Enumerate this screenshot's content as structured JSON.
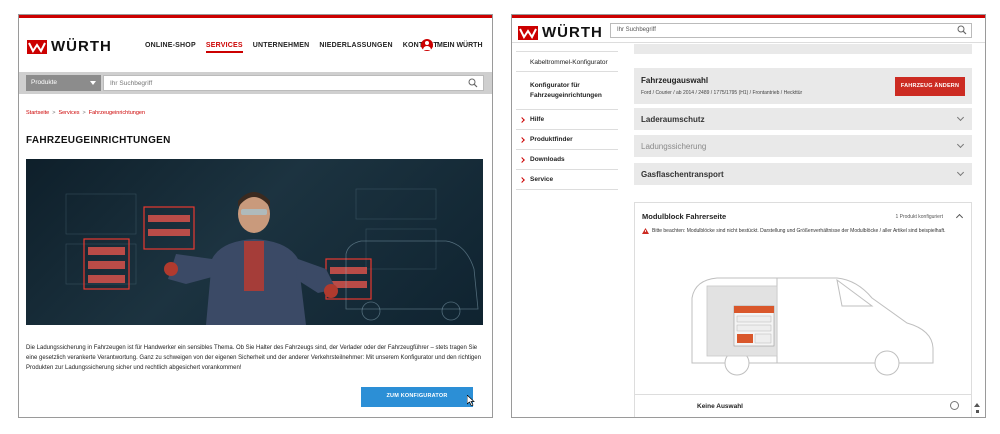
{
  "brand": {
    "name": "WÜRTH",
    "accent": "#cc0000",
    "cta_blue": "#2c8fd6",
    "button_red": "#cc2b22"
  },
  "left": {
    "nav": [
      "ONLINE-SHOP",
      "SERVICES",
      "UNTERNEHMEN",
      "NIEDERLASSUNGEN",
      "KONTAKT"
    ],
    "nav_active": "SERVICES",
    "account_label": "MEIN WÜRTH",
    "search": {
      "category": "Produkte",
      "placeholder": "Ihr Suchbegriff"
    },
    "breadcrumb": [
      "Startseite",
      "Services",
      "Fahrzeugeinrichtungen"
    ],
    "page_title": "FAHRZEUGEINRICHTUNGEN",
    "intro": "Die Ladungssicherung in Fahrzeugen ist für Handwerker ein sensibles Thema. Ob Sie Halter des Fahrzeugs sind, der Verlader oder der Fahrzeugführer – stets tragen Sie eine gesetzlich verankerte Verantwortung. Ganz zu schweigen von der eigenen Sicherheit und der anderer Verkehrsteilnehmer: Mit unserem Konfigurator und den richtigen Produkten zur Ladungssicherung sicher und rechtlich abgesichert vorankommen!",
    "cta_label": "ZUM KONFIGURATOR"
  },
  "right": {
    "search_placeholder": "Ihr Suchbegriff",
    "sidebar": {
      "sub_items": [
        "Kabeltrommel-Konfigurator",
        "Konfigurator für Fahrzeugeinrichtungen"
      ],
      "main_items": [
        "Hilfe",
        "Produktfinder",
        "Downloads",
        "Service"
      ]
    },
    "vehicle": {
      "title": "Fahrzeugauswahl",
      "subtitle": "Ford / Courier / ab 2014 / 2489 / 1775/1795 (H1) / Frontantrieb / Heckttür",
      "change_label": "FAHRZEUG ÄNDERN"
    },
    "accordions": [
      "Laderaumschutz",
      "Ladungssicherung",
      "Gasflaschentransport"
    ],
    "module": {
      "title": "Modulblock Fahrerseite",
      "count": "1 Produkt konfiguriert",
      "warning": "Bitte beachten: Modulblöcke sind nicht bestückt. Darstellung und Größenverhältnisse der Modulblöcke / aller Artikel sind beispielhaft.",
      "option_label": "Keine Auswahl"
    }
  }
}
